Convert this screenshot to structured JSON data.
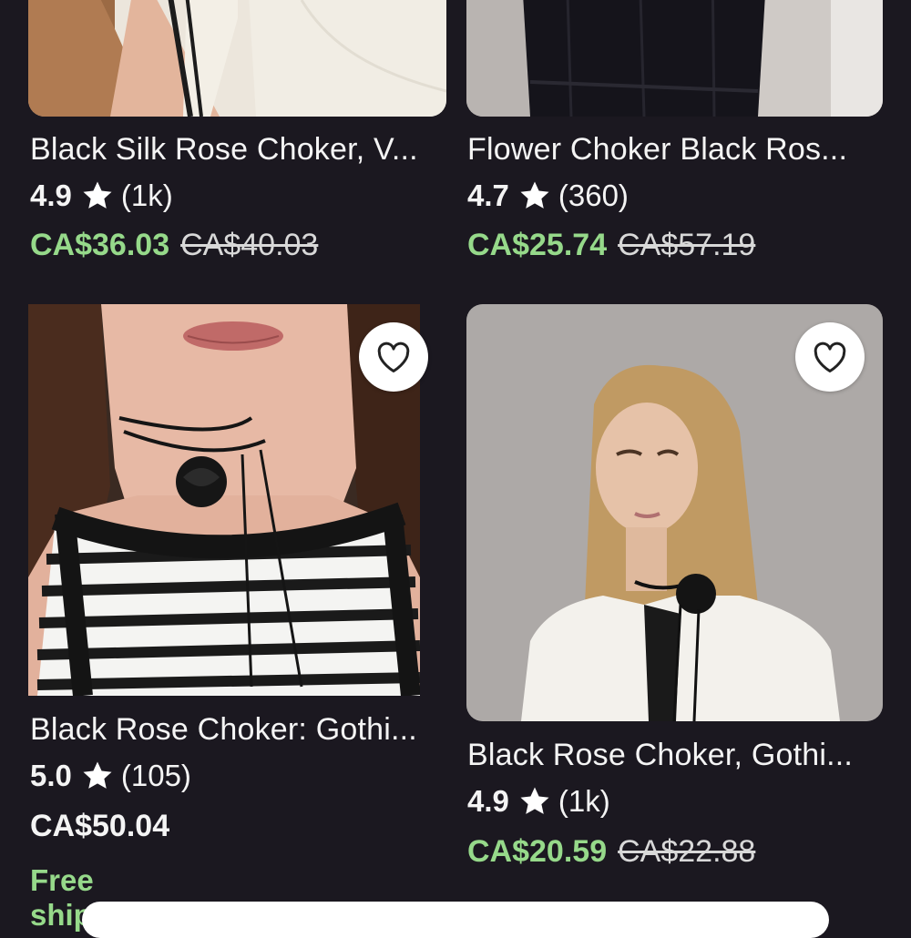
{
  "products": [
    {
      "title": "Black Silk Rose Choker, V...",
      "rating": "4.9",
      "reviews": "(1k)",
      "price": "CA$36.03",
      "original_price": "CA$40.03"
    },
    {
      "title": "Flower Choker Black Ros...",
      "rating": "4.7",
      "reviews": "(360)",
      "price": "CA$25.74",
      "original_price": "CA$57.19"
    },
    {
      "title": "Black Rose Choker: Gothi...",
      "rating": "5.0",
      "reviews": "(105)",
      "price": "CA$50.04",
      "shipping": "Free shipping",
      "favorite_icon": "heart-outline-icon"
    },
    {
      "title": "Black Rose Choker, Gothi...",
      "rating": "4.9",
      "reviews": "(1k)",
      "price": "CA$20.59",
      "original_price": "CA$22.88",
      "favorite_icon": "heart-outline-icon"
    }
  ],
  "colors": {
    "background": "#1b1820",
    "sale_price": "#96d98a",
    "shipping": "#96d98a",
    "text": "#f4f4f4"
  },
  "icons": {
    "star": "star-icon",
    "heart": "heart-outline-icon"
  }
}
